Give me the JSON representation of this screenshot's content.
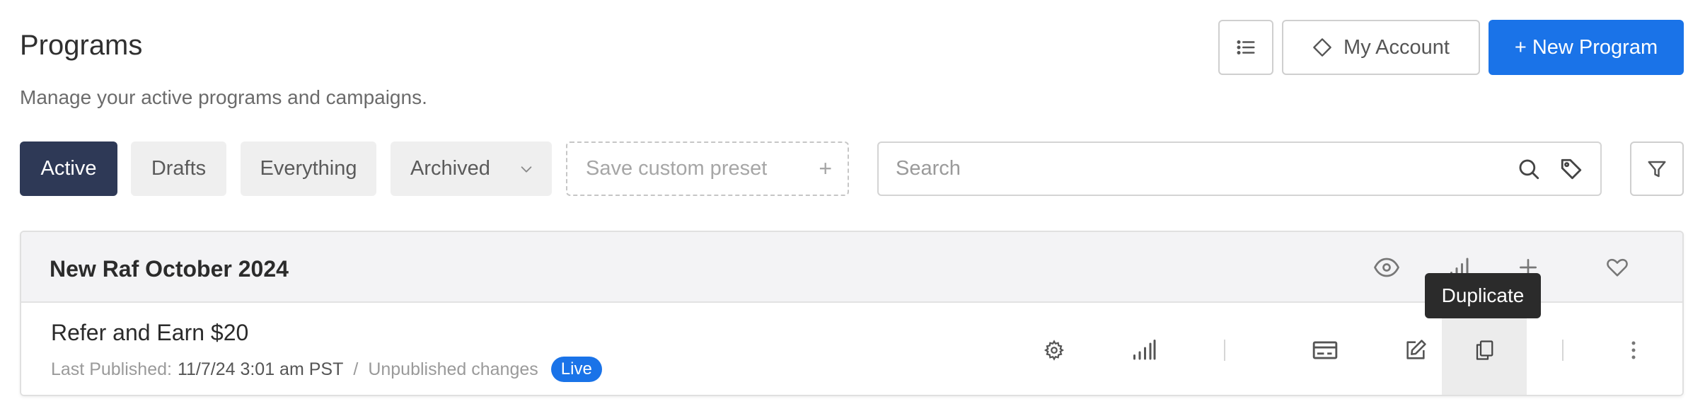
{
  "header": {
    "title": "Programs",
    "subtitle": "Manage your active programs and campaigns.",
    "my_account_label": "My Account",
    "new_program_label": "+ New Program"
  },
  "filters": {
    "active": "Active",
    "drafts": "Drafts",
    "everything": "Everything",
    "archived": "Archived",
    "save_preset": "Save custom preset",
    "save_preset_icon": "+"
  },
  "search": {
    "placeholder": "Search"
  },
  "program_group": {
    "title": "New Raf October 2024",
    "program": {
      "title": "Refer and Earn $20",
      "last_published_label": "Last Published:",
      "last_published_value": "11/7/24 3:01 am PST",
      "separator": "/",
      "unpublished": "Unpublished changes",
      "status": "Live"
    }
  },
  "tooltip": "Duplicate",
  "colors": {
    "primary": "#1a73e8",
    "active_pill": "#2e3956",
    "tooltip_bg": "#2b2b2b",
    "live_badge": "#1a73e8"
  }
}
